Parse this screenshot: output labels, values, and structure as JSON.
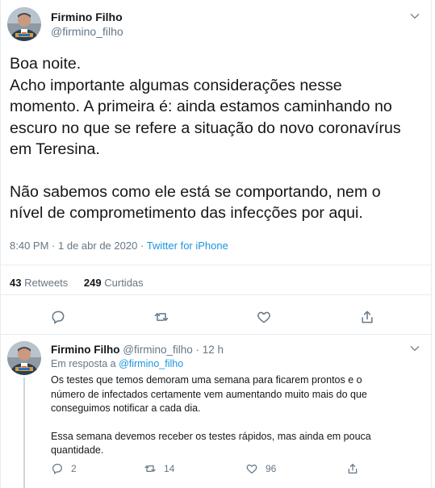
{
  "main_tweet": {
    "author_name": "Firmino Filho",
    "author_handle": "@firmino_filho",
    "text_lines": [
      "Boa noite.",
      "Acho importante algumas considerações nesse",
      "momento. A primeira é: ainda estamos caminhando no",
      "escuro no que se refere a situação do novo coronavírus",
      "em Teresina.",
      "Não sabemos como ele está se comportando, nem o",
      "nível de comprometimento das infecções por aqui."
    ],
    "time": "8:40 PM",
    "separator": "·",
    "date": "1 de abr de 2020",
    "source": "Twitter for iPhone",
    "retweets_count": "43",
    "retweets_label": "Retweets",
    "likes_count": "249",
    "likes_label": "Curtidas"
  },
  "reply": {
    "author_name": "Firmino Filho",
    "author_handle": "@firmino_filho",
    "separator": "·",
    "time_ago": "12 h",
    "reply_prefix": "Em resposta a",
    "reply_to_handle": "@firmino_filho",
    "text_lines": [
      "Os testes que temos demoram uma semana para ficarem prontos e o",
      "número de infectados certamente vem aumentando muito mais do que",
      "conseguimos notificar a cada dia.",
      "Essa semana devemos receber os testes rápidos, mas ainda em pouca",
      "quantidade."
    ],
    "replies_count": "2",
    "retweets_count": "14",
    "likes_count": "96"
  },
  "icons": {
    "reply": "speech-bubble-icon",
    "retweet": "retweet-arrows-icon",
    "like": "heart-icon",
    "share": "share-upload-icon",
    "menu": "chevron-down-icon"
  },
  "colors": {
    "text": "#14171a",
    "muted": "#657786",
    "link": "#1b95e0",
    "border": "#e6ecf0"
  }
}
